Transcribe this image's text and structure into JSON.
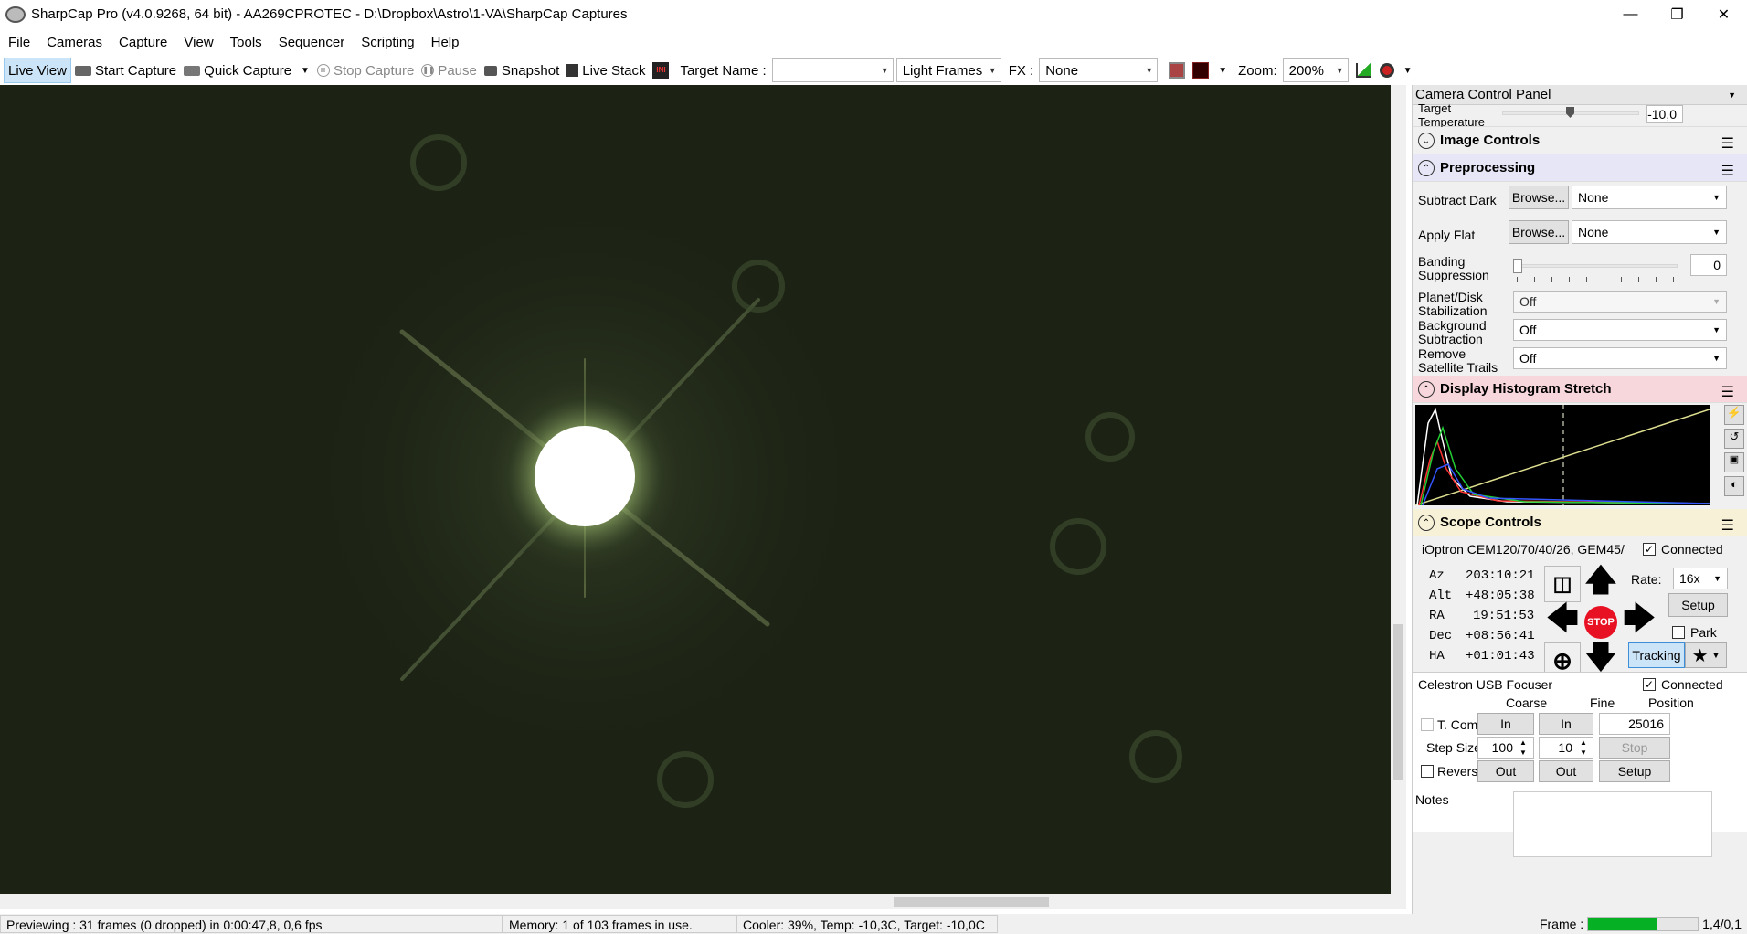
{
  "window": {
    "title": "SharpCap Pro (v4.0.9268, 64 bit) - AA269CPROTEC - D:\\Dropbox\\Astro\\1-VA\\SharpCap Captures",
    "minimize": "—",
    "maximize": "❐",
    "close": "✕"
  },
  "menu": [
    "File",
    "Cameras",
    "Capture",
    "View",
    "Tools",
    "Sequencer",
    "Scripting",
    "Help"
  ],
  "toolbar": {
    "live_view": "Live View",
    "start_capture": "Start Capture",
    "quick_capture": "Quick Capture",
    "stop_capture": "Stop Capture",
    "pause": "Pause",
    "snapshot": "Snapshot",
    "live_stack": "Live Stack",
    "target_name_label": "Target Name :",
    "target_name_value": "",
    "frame_type": "Light Frames",
    "fx_label": "FX :",
    "fx_value": "None",
    "zoom_label": "Zoom:",
    "zoom_value": "200%"
  },
  "panel": {
    "title": "Camera Control Panel",
    "target_temp_label": "Target\nTemperature",
    "target_temp_value": "-10,0",
    "image_controls": "Image Controls",
    "preprocessing": "Preprocessing",
    "subtract_dark_label": "Subtract Dark",
    "browse": "Browse...",
    "subtract_dark_value": "None",
    "apply_flat_label": "Apply Flat",
    "apply_flat_value": "None",
    "banding_label": "Banding\nSuppression",
    "banding_value": "0",
    "stabilization_label": "Planet/Disk\nStabilization",
    "stabilization_value": "Off",
    "background_label": "Background\nSubtraction",
    "background_value": "Off",
    "satellite_label": "Remove\nSatellite Trails",
    "satellite_value": "Off",
    "histogram": "Display Histogram Stretch",
    "scope_controls": "Scope Controls",
    "mount_name": "iOptron CEM120/70/40/26, GEM45/",
    "connected": "Connected",
    "coords": [
      {
        "label": "Az",
        "value": "203:10:21"
      },
      {
        "label": "Alt",
        "value": "+48:05:38"
      },
      {
        "label": "RA",
        "value": "19:51:53"
      },
      {
        "label": "Dec",
        "value": "+08:56:41"
      },
      {
        "label": "HA",
        "value": "+01:01:43"
      }
    ],
    "rate_label": "Rate:",
    "rate_value": "16x",
    "setup": "Setup",
    "stop": "STOP",
    "park": "Park",
    "tracking": "Tracking",
    "focuser_name": "Celestron USB Focuser",
    "coarse": "Coarse",
    "fine": "Fine",
    "position": "Position",
    "t_comp": "T. Comp",
    "in": "In",
    "out": "Out",
    "position_value": "25016",
    "step_size_label": "Step Size",
    "coarse_step": "100",
    "fine_step": "10",
    "stop_btn": "Stop",
    "reverse": "Reverse",
    "notes": "Notes"
  },
  "status": {
    "previewing": "Previewing : 31 frames (0 dropped) in 0:00:47,8, 0,6 fps",
    "memory": "Memory: 1 of 103 frames in use.",
    "cooler": "Cooler: 39%, Temp: -10,3C, Target: -10,0C",
    "frame_label": "Frame :",
    "frame_progress": 0.62,
    "frame_value": "1,4/0,1"
  },
  "colors": {
    "accent": "#cce4f7",
    "histogram_header": "#f7d7dc",
    "preprocessing_header": "#e6e6f7",
    "scope_header": "#f7f2d7",
    "progress": "#06b025",
    "stop_red": "#e81123"
  }
}
